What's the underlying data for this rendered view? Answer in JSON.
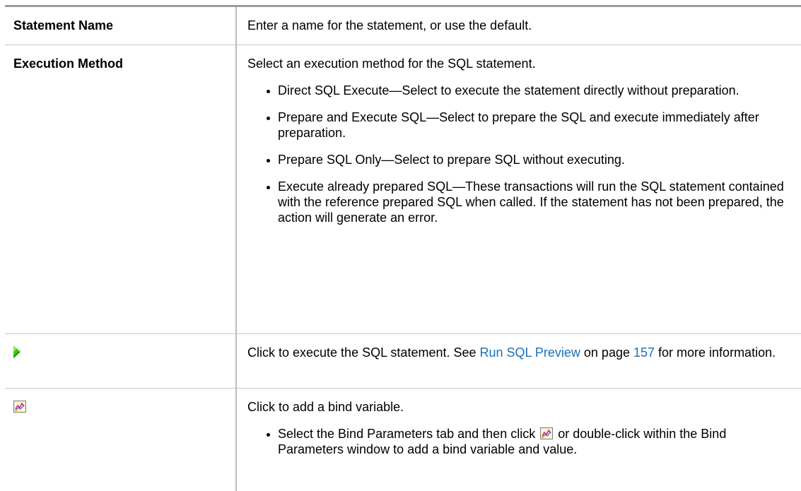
{
  "rows": [
    {
      "term": "Statement Name",
      "description": "Enter a name for the statement, or use the default."
    },
    {
      "term": "Execution Method",
      "description": "Select an execution method for the SQL statement.",
      "bullets": [
        "Direct SQL Execute—Select to execute the statement directly without preparation.",
        "Prepare and Execute SQL—Select to prepare the SQL and execute immediately after preparation.",
        "Prepare SQL Only—Select to prepare SQL without executing.",
        "Execute already prepared SQL—These transactions will run the SQL statement contained with the reference prepared SQL when called. If the statement has not been prepared, the action will generate an error."
      ]
    },
    {
      "term_icon": "run-sql-icon",
      "description_before": "Click to execute the SQL statement. See ",
      "link_text": "Run SQL Preview",
      "description_middle": " on page ",
      "page_link": "157",
      "description_after": " for more information."
    },
    {
      "term_icon": "bind-variable-icon",
      "description": "Click to add a bind variable.",
      "bullet_before_icon": "Select the Bind Parameters tab and then click ",
      "bullet_after_icon": " or double-click within the Bind Parameters window to add a bind variable and value."
    }
  ],
  "colors": {
    "link": "#1c6fb8",
    "run_icon": "#33cc00",
    "header_rule": "#9a9a9a",
    "row_rule": "#c6c6c6"
  }
}
